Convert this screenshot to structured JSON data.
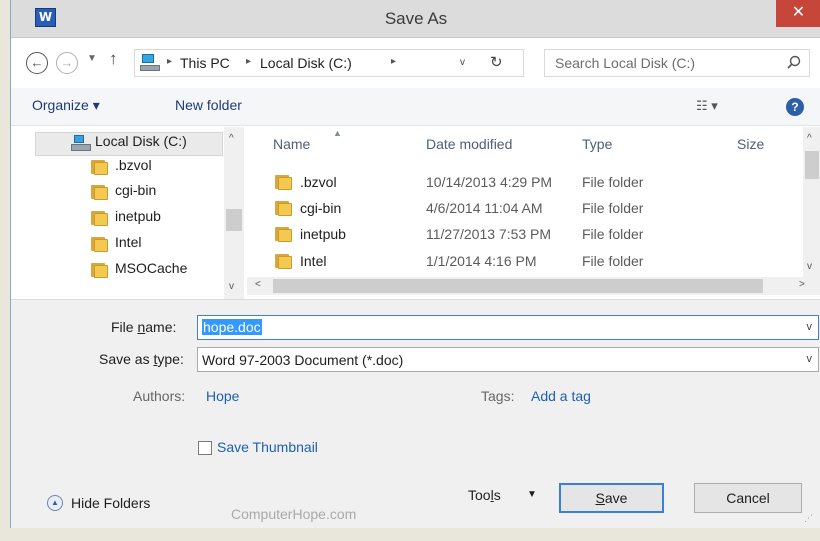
{
  "window": {
    "title": "Save As",
    "app_icon": "W",
    "close_glyph": "✕"
  },
  "nav": {
    "back_glyph": "←",
    "forward_glyph": "→",
    "recent_glyph": "▼",
    "up_glyph": "↑"
  },
  "address": {
    "crumbs": [
      "This PC",
      "Local Disk (C:)"
    ],
    "separator": "▸",
    "dropdown_glyph": "v",
    "refresh_glyph": "↻"
  },
  "search": {
    "placeholder": "Search Local Disk (C:)"
  },
  "toolbar": {
    "organize": "Organize ▾",
    "new_folder": "New folder",
    "view_glyph": "☷ ▾",
    "help_glyph": "?"
  },
  "nav_pane": {
    "selected": "Local Disk (C:)",
    "items": [
      ".bzvol",
      "cgi-bin",
      "inetpub",
      "Intel",
      "MSOCache"
    ]
  },
  "file_list": {
    "columns": {
      "name": "Name",
      "date": "Date modified",
      "type": "Type",
      "size": "Size"
    },
    "rows": [
      {
        "name": ".bzvol",
        "date": "10/14/2013 4:29 PM",
        "type": "File folder"
      },
      {
        "name": "cgi-bin",
        "date": "4/6/2014 11:04 AM",
        "type": "File folder"
      },
      {
        "name": "inetpub",
        "date": "11/27/2013 7:53 PM",
        "type": "File folder"
      },
      {
        "name": "Intel",
        "date": "1/1/2014 4:16 PM",
        "type": "File folder"
      }
    ]
  },
  "form": {
    "file_name_label_pre": "File ",
    "file_name_label_ul": "n",
    "file_name_label_post": "ame:",
    "file_name": "hope.doc",
    "save_type_label_pre": "Save as ",
    "save_type_label_ul": "t",
    "save_type_label_post": "ype:",
    "save_type": "Word 97-2003 Document (*.doc)",
    "authors_label": "Authors:",
    "authors": "Hope",
    "tags_label": "Tags:",
    "tags_placeholder": "Add a tag",
    "thumbnail_label": "Save Thumbnail",
    "thumbnail_checked": false
  },
  "footer": {
    "hide_folders": "Hide Folders",
    "tools_pre": "Too",
    "tools_ul": "l",
    "tools_post": "s",
    "tools_arrow": "▼",
    "save_ul": "S",
    "save_post": "ave",
    "cancel": "Cancel",
    "watermark": "ComputerHope.com"
  }
}
